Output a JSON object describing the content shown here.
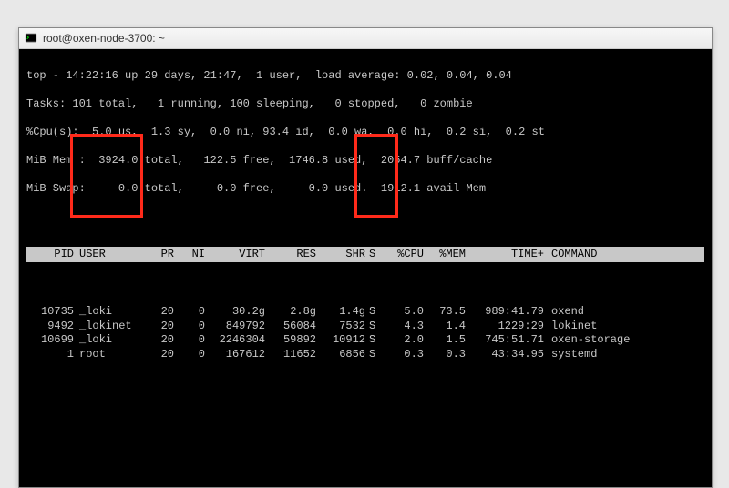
{
  "window": {
    "title": "root@oxen-node-3700: ~"
  },
  "summary": {
    "line1": "top - 14:22:16 up 29 days, 21:47,  1 user,  load average: 0.02, 0.04, 0.04",
    "line2": "Tasks: 101 total,   1 running, 100 sleeping,   0 stopped,   0 zombie",
    "line3": "%Cpu(s):  5.0 us,  1.3 sy,  0.0 ni, 93.4 id,  0.0 wa,  0.0 hi,  0.2 si,  0.2 st",
    "line4": "MiB Mem :  3924.0 total,   122.5 free,  1746.8 used,  2054.7 buff/cache",
    "line5": "MiB Swap:     0.0 total,     0.0 free,     0.0 used.  1912.1 avail Mem"
  },
  "headers": {
    "pid": "PID",
    "user": "USER",
    "pr": "PR",
    "ni": "NI",
    "virt": "VIRT",
    "res": "RES",
    "shr": "SHR",
    "s": "S",
    "cpu": "%CPU",
    "mem": "%MEM",
    "time": "TIME+",
    "cmd": "COMMAND"
  },
  "rows": [
    {
      "pid": "10735",
      "user": "_loki",
      "pr": "20",
      "ni": "0",
      "virt": "30.2g",
      "res": "2.8g",
      "shr": "1.4g",
      "s": "S",
      "cpu": "5.0",
      "mem": "73.5",
      "time": "989:41.79",
      "cmd": "oxend"
    },
    {
      "pid": "9492",
      "user": "_lokinet",
      "pr": "20",
      "ni": "0",
      "virt": "849792",
      "res": "56084",
      "shr": "7532",
      "s": "S",
      "cpu": "4.3",
      "mem": "1.4",
      "time": "1229:29",
      "cmd": "lokinet"
    },
    {
      "pid": "10699",
      "user": "_loki",
      "pr": "20",
      "ni": "0",
      "virt": "2246304",
      "res": "59892",
      "shr": "10912",
      "s": "S",
      "cpu": "2.0",
      "mem": "1.5",
      "time": "745:51.71",
      "cmd": "oxen-storage"
    },
    {
      "pid": "1",
      "user": "root",
      "pr": "20",
      "ni": "0",
      "virt": "167612",
      "res": "11652",
      "shr": "6856",
      "s": "S",
      "cpu": "0.3",
      "mem": "0.3",
      "time": "43:34.95",
      "cmd": "systemd"
    }
  ],
  "highlight_columns": [
    "USER",
    "%CPU"
  ]
}
